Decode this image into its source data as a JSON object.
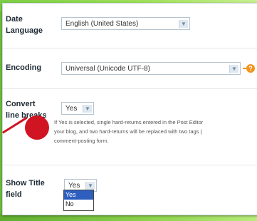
{
  "settings": {
    "date_language": {
      "label_line1": "Date",
      "label_line2": "Language",
      "value": "English (United States)"
    },
    "encoding": {
      "label": "Encoding",
      "value": "Universal (Unicode UTF-8)"
    },
    "convert_line_breaks": {
      "label_line1": "Convert",
      "label_line2": "line breaks",
      "value": "Yes",
      "help_line1": "If Yes is selected, single hard-returns entered in the Post Editor",
      "help_line2": "your blog, and two hard-returns will be replaced with two tags (",
      "help_line3": "comment-posting form."
    },
    "show_title_field": {
      "label_line1": "Show Title",
      "label_line2": "field",
      "value": "Yes",
      "options": [
        "Yes",
        "No"
      ]
    }
  },
  "colors": {
    "accent_marker": "#d01421",
    "help_icon": "#f2941d",
    "selected_option": "#2e5fbf",
    "background_green": "#6fbf3d"
  },
  "icons": {
    "dropdown_arrow": "chevron-down-icon",
    "help": "help-icon"
  }
}
